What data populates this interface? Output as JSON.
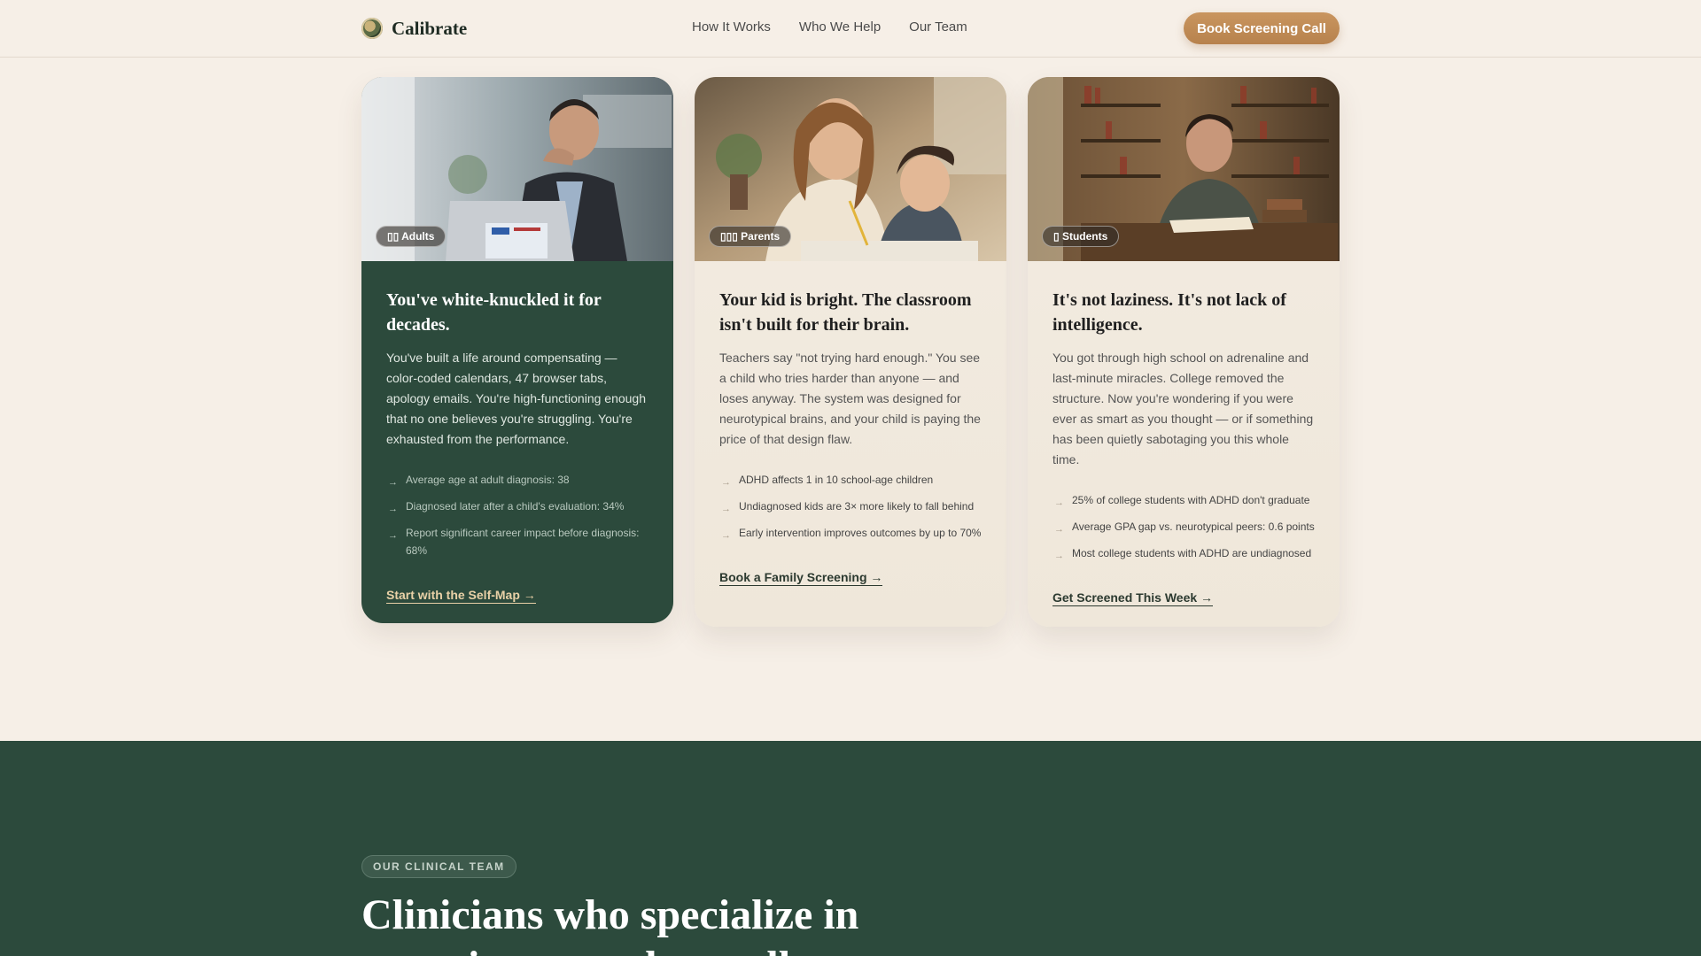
{
  "header": {
    "brand": "Calibrate",
    "nav": [
      "How It Works",
      "Who We Help",
      "Our Team"
    ],
    "cta": "Book Screening Call"
  },
  "cards": [
    {
      "tag": "▯▯ Adults",
      "title": "You've white-knuckled it for decades.",
      "description": "You've built a life around compensating — color-coded calendars, 47 browser tabs, apology emails. You're high-functioning enough that no one believes you're struggling. You're exhausted from the performance.",
      "stats": [
        "Average age at adult diagnosis: 38",
        "Diagnosed later after a child's evaluation: 34%",
        "Report significant career impact before diagnosis: 68%"
      ],
      "link": "Start with the Self-Map →"
    },
    {
      "tag": "▯▯▯ Parents",
      "title": "Your kid is bright. The classroom isn't built for their brain.",
      "description": "Teachers say \"not trying hard enough.\" You see a child who tries harder than anyone — and loses anyway. The system was designed for neurotypical brains, and your child is paying the price of that design flaw.",
      "stats": [
        "ADHD affects 1 in 10 school-age children",
        "Undiagnosed kids are 3× more likely to fall behind",
        "Early intervention improves outcomes by up to 70%"
      ],
      "link": "Book a Family Screening →"
    },
    {
      "tag": "▯ Students",
      "title": "It's not laziness. It's not lack of intelligence.",
      "description": "You got through high school on adrenaline and last-minute miracles. College removed the structure. Now you're wondering if you were ever as smart as you thought — or if something has been quietly sabotaging you this whole time.",
      "stats": [
        "25% of college students with ADHD don't graduate",
        "Average GPA gap vs. neurotypical peers: 0.6 points",
        "Most college students with ADHD are undiagnosed"
      ],
      "link": "Get Screened This Week →"
    }
  ],
  "team": {
    "badge": "OUR CLINICAL TEAM",
    "title": "Clinicians who specialize in attention — and actually"
  }
}
